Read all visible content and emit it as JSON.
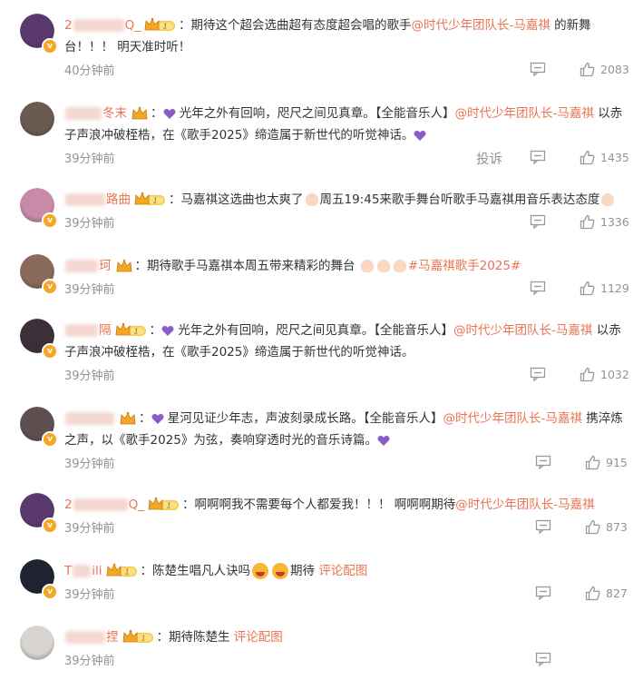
{
  "comments": [
    {
      "username_visible": "2",
      "username_suffix": "Q_",
      "level": "1",
      "segments": [
        {
          "t": "text",
          "v": "：期待这个超会选曲超有态度超会唱的歌手"
        },
        {
          "t": "mention",
          "v": "@时代少年团队长-马嘉祺"
        },
        {
          "t": "text",
          "v": " 的新舞台！！！ 明天准时听！"
        }
      ],
      "time": "40分钟前",
      "likes": "2083",
      "avatar_color": "#5a3a6e"
    },
    {
      "username_visible": "",
      "username_suffix": "冬末",
      "level": "",
      "segments": [
        {
          "t": "text",
          "v": "："
        },
        {
          "t": "heart",
          "v": "💜"
        },
        {
          "t": "text",
          "v": " 光年之外有回响，咫尺之间见真章。【全能音乐人】"
        },
        {
          "t": "mention",
          "v": "@时代少年团队长-马嘉祺"
        },
        {
          "t": "text",
          "v": " 以赤子声浪冲破桎梏，在《歌手2025》缔造属于新世代的听觉神话。"
        },
        {
          "t": "heart",
          "v": "💜"
        }
      ],
      "time": "39分钟前",
      "report": "投诉",
      "likes": "1435",
      "avatar_color": "#6b5a52"
    },
    {
      "username_visible": "",
      "username_suffix": "路曲",
      "level": "1",
      "segments": [
        {
          "t": "text",
          "v": "：马嘉祺这选曲也太爽了"
        },
        {
          "t": "clap",
          "v": ""
        },
        {
          "t": "text",
          "v": "周五19:45来歌手舞台听歌手马嘉祺用音乐表达态度"
        },
        {
          "t": "clap",
          "v": ""
        }
      ],
      "time": "39分钟前",
      "likes": "1336",
      "avatar_color": "#c98aa8"
    },
    {
      "username_visible": "",
      "username_suffix": "珂",
      "level": "",
      "segments": [
        {
          "t": "text",
          "v": "：期待歌手马嘉祺本周五带来精彩的舞台 "
        },
        {
          "t": "clap",
          "v": ""
        },
        {
          "t": "clap",
          "v": ""
        },
        {
          "t": "clap",
          "v": ""
        },
        {
          "t": "mention",
          "v": "#马嘉祺歌手2025#"
        }
      ],
      "time": "39分钟前",
      "likes": "1129",
      "avatar_color": "#8a6a5a"
    },
    {
      "username_visible": "",
      "username_suffix": "隔",
      "level": "1",
      "segments": [
        {
          "t": "text",
          "v": "："
        },
        {
          "t": "heart",
          "v": "💜"
        },
        {
          "t": "text",
          "v": " 光年之外有回响，咫尺之间见真章。【全能音乐人】"
        },
        {
          "t": "mention",
          "v": "@时代少年团队长-马嘉祺"
        },
        {
          "t": "text",
          "v": " 以赤子声浪冲破桎梏，在《歌手2025》缔造属于新世代的听觉神话。"
        }
      ],
      "time": "39分钟前",
      "likes": "1032",
      "avatar_color": "#3d2f3a"
    },
    {
      "username_visible": "",
      "username_suffix": "",
      "level": "",
      "segments": [
        {
          "t": "text",
          "v": "："
        },
        {
          "t": "heart",
          "v": "💜"
        },
        {
          "t": "text",
          "v": " 星河见证少年志，声波刻录成长路。【全能音乐人】"
        },
        {
          "t": "mention",
          "v": "@时代少年团队长-马嘉祺"
        },
        {
          "t": "text",
          "v": " 携淬炼之声，以《歌手2025》为弦，奏响穿透时光的音乐诗篇。"
        },
        {
          "t": "heart",
          "v": "💜"
        }
      ],
      "time": "39分钟前",
      "likes": "915",
      "avatar_color": "#5e5050"
    },
    {
      "username_visible": "2",
      "username_suffix": "Q_",
      "level": "1",
      "segments": [
        {
          "t": "text",
          "v": "：啊啊啊我不需要每个人都爱我！！！ 啊啊啊期待"
        },
        {
          "t": "mention",
          "v": "@时代少年团队长-马嘉祺"
        }
      ],
      "time": "39分钟前",
      "likes": "873",
      "avatar_color": "#5a3a6e"
    },
    {
      "username_visible": "T",
      "username_suffix": "ili",
      "level": "1",
      "segments": [
        {
          "t": "text",
          "v": "：陈楚生唱凡人诀吗"
        },
        {
          "t": "laugh",
          "v": ""
        },
        {
          "t": "laugh",
          "v": ""
        },
        {
          "t": "text",
          "v": "期待 "
        },
        {
          "t": "mention",
          "v": "评论配图"
        }
      ],
      "time": "39分钟前",
      "likes": "827",
      "avatar_color": "#1f2230"
    },
    {
      "username_visible": "",
      "username_suffix": "捏",
      "level": "1",
      "segments": [
        {
          "t": "text",
          "v": "：期待陈楚生 "
        },
        {
          "t": "mention",
          "v": "评论配图"
        }
      ],
      "time": "39分钟前",
      "likes": "",
      "avatar_color": "#d8d4d0"
    }
  ],
  "colors": {
    "accent": "#eb7350",
    "meta": "#939393",
    "crown": "#f5b800"
  }
}
